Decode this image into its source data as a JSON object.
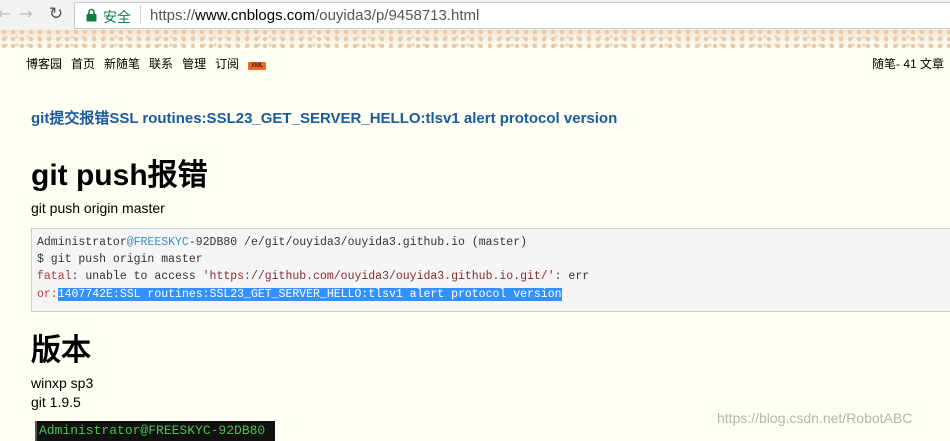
{
  "browser": {
    "secure_label": "安全",
    "url_scheme": "https://",
    "url_host": "www.cnblogs.com",
    "url_path": "/ouyida3/p/9458713.html"
  },
  "site_nav": {
    "items": [
      "博客园",
      "首页",
      "新随笔",
      "联系",
      "管理",
      "订阅"
    ],
    "rss_badge": "XML",
    "stats": "随笔- 41  文章"
  },
  "article": {
    "post_title": "git提交报错SSL routines:SSL23_GET_SERVER_HELLO:tlsv1 alert protocol version",
    "heading_1": "git push报错",
    "para_1": "git push origin master",
    "code": {
      "line1_user": "Administrator",
      "line1_host": "@FREESKYC",
      "line1_rest": "-92DB80 /e/git/ouyida3/ouyida3.github.io (master)",
      "line2": "$ git push origin master",
      "line3_fatal": "fatal",
      "line3_mid": ": unable to access ",
      "line3_url": "'https://github.com/ouyida3/ouyida3.github.io.git/'",
      "line3_end": ": err",
      "line4_prefix": "or:",
      "line4_selected": "1407742E:SSL routines:SSL23_GET_SERVER_HELLO:tlsv1 alert protocol version"
    },
    "heading_2": "版本",
    "para_2": "winxp sp3",
    "para_3": "git 1.9.5",
    "terminal_line": "Administrator@FREESKYC-92DB80"
  },
  "watermark": "https://blog.csdn.net/RobotABC",
  "colors": {
    "page_background": "#fefef2",
    "title_link": "#1a5a9e",
    "secure_green": "#0b8043",
    "selection": "#3390ff"
  }
}
